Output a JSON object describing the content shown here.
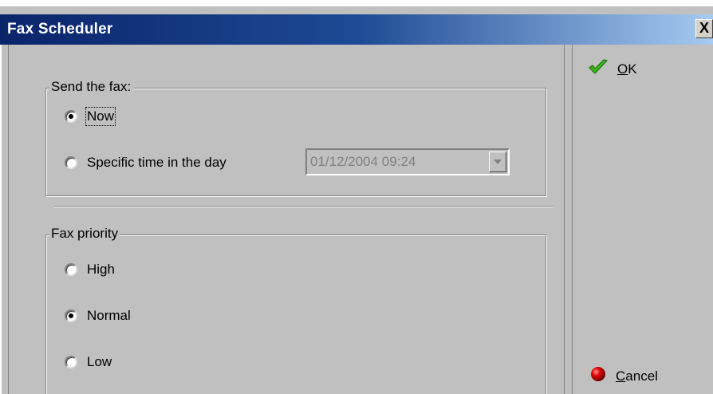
{
  "window": {
    "title": "Fax Scheduler",
    "close_glyph": "X"
  },
  "send_group": {
    "label": "Send the fax:",
    "options": [
      {
        "label": "Now",
        "checked": true
      },
      {
        "label": "Specific time in the day",
        "checked": false
      }
    ],
    "datetime_value": "01/12/2004 09:24"
  },
  "priority_group": {
    "label": "Fax priority",
    "options": [
      {
        "label": "High",
        "checked": false
      },
      {
        "label": "Normal",
        "checked": true
      },
      {
        "label": "Low",
        "checked": false
      }
    ]
  },
  "actions": {
    "ok_accel": "O",
    "ok_rest": "K",
    "cancel_accel": "C",
    "cancel_rest": "ancel"
  },
  "icons": {
    "ok": "green-checkmark-icon",
    "cancel": "red-circle-icon",
    "dropdown": "dropdown-arrow-icon"
  },
  "colors": {
    "titlebar_start": "#0a246a",
    "titlebar_end": "#a6caf0",
    "dialog_bg": "#c0c0c0",
    "ok_icon": "#3cb81c",
    "cancel_icon": "#e00000"
  }
}
